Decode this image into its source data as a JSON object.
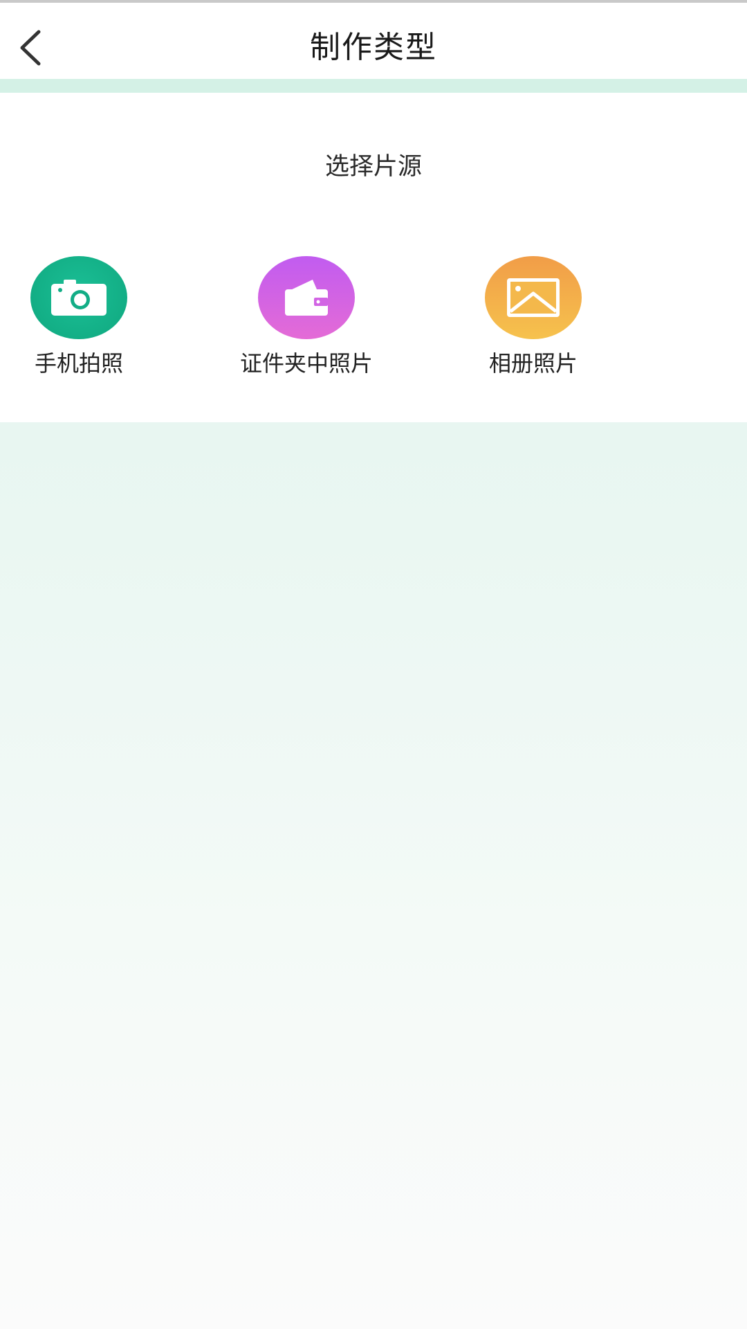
{
  "header": {
    "title": "制作类型"
  },
  "source_panel": {
    "title": "选择片源",
    "options": [
      {
        "label": "手机拍照",
        "icon": "camera-icon",
        "color": "#14b38a"
      },
      {
        "label": "证件夹中照片",
        "icon": "wallet-icon",
        "color": "#d564e2"
      },
      {
        "label": "相册照片",
        "icon": "image-icon",
        "color": "#f3ad4a"
      }
    ]
  }
}
